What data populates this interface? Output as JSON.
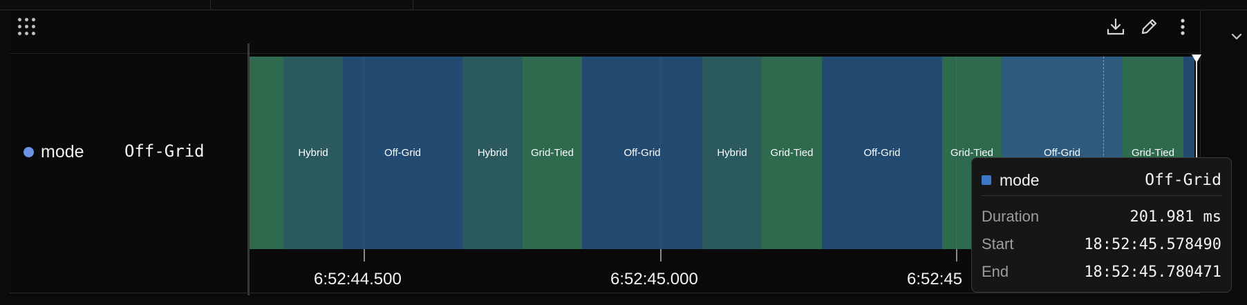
{
  "toolbar": {
    "drag_handle_icon": "grip-dots-icon",
    "download_icon": "download-icon",
    "edit_icon": "pencil-icon",
    "more_icon": "more-vertical-icon",
    "collapse_icon": "chevron-down-icon"
  },
  "row": {
    "name": "mode",
    "value": "Off-Grid",
    "dot_color": "#6b93e6"
  },
  "colors": {
    "Hybrid": "#2b5a5e",
    "Off-Grid": "#234a70",
    "Grid-Tied": "#2e6a4e",
    "hovered": "#2f5a80"
  },
  "segments": [
    {
      "label": "",
      "state": "Grid-Tied"
    },
    {
      "label": "Hybrid",
      "state": "Hybrid"
    },
    {
      "label": "Off-Grid",
      "state": "Off-Grid"
    },
    {
      "label": "Hybrid",
      "state": "Hybrid"
    },
    {
      "label": "Grid-Tied",
      "state": "Grid-Tied"
    },
    {
      "label": "Off-Grid",
      "state": "Off-Grid"
    },
    {
      "label": "Hybrid",
      "state": "Hybrid"
    },
    {
      "label": "Grid-Tied",
      "state": "Grid-Tied"
    },
    {
      "label": "Off-Grid",
      "state": "Off-Grid"
    },
    {
      "label": "Grid-Tied",
      "state": "Grid-Tied"
    },
    {
      "label": "Off-Grid",
      "state": "Off-Grid",
      "hovered": true
    },
    {
      "label": "Grid-Tied",
      "state": "Grid-Tied"
    },
    {
      "label": "",
      "state": "Off-Grid"
    }
  ],
  "axis": {
    "ticks": [
      "6:52:44.500",
      "6:52:45.000",
      "6:52:45"
    ]
  },
  "tooltip": {
    "name": "mode",
    "value": "Off-Grid",
    "rows": [
      {
        "key": "Duration",
        "value": "201.981 ms"
      },
      {
        "key": "Start",
        "value": "18:52:45.578490"
      },
      {
        "key": "End",
        "value": "18:52:45.780471"
      }
    ]
  }
}
